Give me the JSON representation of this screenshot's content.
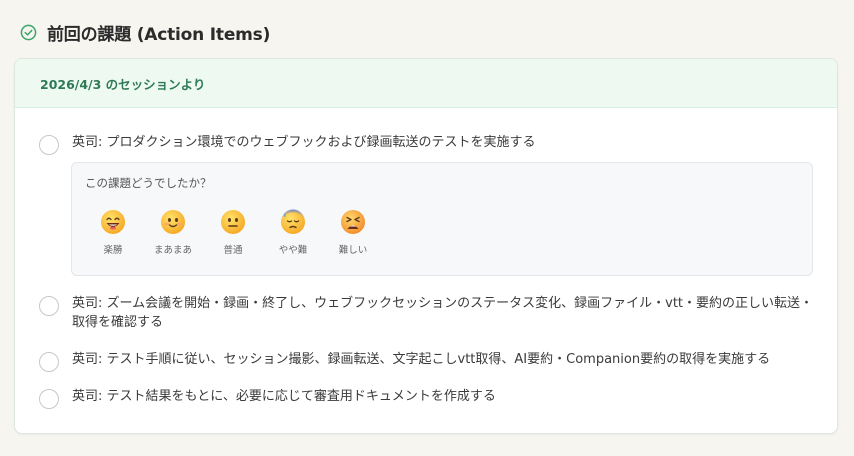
{
  "section": {
    "icon": "check-circle-icon",
    "title": "前回の課題 (Action Items)",
    "accent": "#3aa56a"
  },
  "card": {
    "header": "2026/4/3 のセッションより"
  },
  "items": [
    {
      "text": "英司: プロダクション環境でのウェブフックおよび録画転送のテストを実施する"
    },
    {
      "text": "英司: ズーム会議を開始・録画・終了し、ウェブフックセッションのステータス変化、録画ファイル・vtt・要約の正しい転送・取得を確認する"
    },
    {
      "text": "英司: テスト手順に従い、セッション撮影、録画転送、文字起こしvtt取得、AI要約・Companion要約の取得を実施する"
    },
    {
      "text": "英司: テスト結果をもとに、必要に応じて審査用ドキュメントを作成する"
    }
  ],
  "feedback": {
    "question": "この課題どうでしたか？",
    "options": [
      {
        "label": "楽勝",
        "icon": "grinning-face-icon"
      },
      {
        "label": "まあまあ",
        "icon": "slightly-smiling-face-icon"
      },
      {
        "label": "普通",
        "icon": "neutral-face-icon"
      },
      {
        "label": "やや難",
        "icon": "downcast-sweat-face-icon"
      },
      {
        "label": "難しい",
        "icon": "tired-face-icon"
      }
    ]
  }
}
